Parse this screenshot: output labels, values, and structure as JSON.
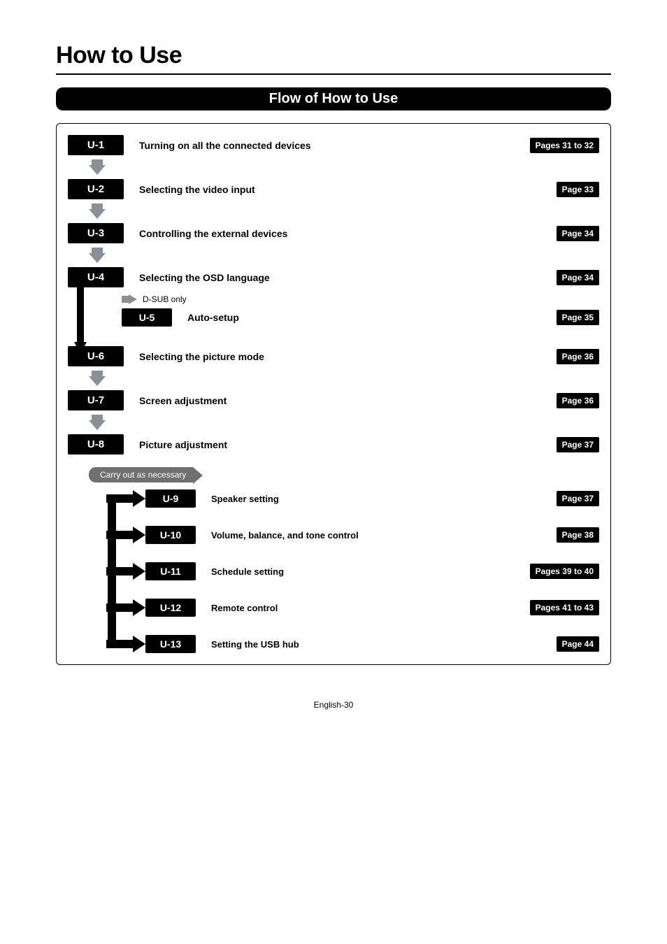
{
  "page_title": "How to Use",
  "section_bar": "Flow of How to Use",
  "steps": {
    "u1": {
      "id": "U-1",
      "title": "Turning on all the connected devices",
      "page": "Pages 31 to 32"
    },
    "u2": {
      "id": "U-2",
      "title": "Selecting the video input",
      "page": "Page 33"
    },
    "u3": {
      "id": "U-3",
      "title": "Controlling the external devices",
      "page": "Page 34"
    },
    "u4": {
      "id": "U-4",
      "title": "Selecting the OSD language",
      "page": "Page 34"
    },
    "u5": {
      "id": "U-5",
      "title": "Auto-setup",
      "page": "Page 35",
      "note": "D-SUB only"
    },
    "u6": {
      "id": "U-6",
      "title": "Selecting the picture mode",
      "page": "Page 36"
    },
    "u7": {
      "id": "U-7",
      "title": "Screen adjustment",
      "page": "Page 36"
    },
    "u8": {
      "id": "U-8",
      "title": "Picture adjustment",
      "page": "Page 37"
    }
  },
  "branch_note": "Carry out as necessary",
  "branches": {
    "u9": {
      "id": "U-9",
      "title": "Speaker setting",
      "page": "Page 37"
    },
    "u10": {
      "id": "U-10",
      "title": "Volume, balance, and tone control",
      "page": "Page 38"
    },
    "u11": {
      "id": "U-11",
      "title": "Schedule setting",
      "page": "Pages 39 to 40"
    },
    "u12": {
      "id": "U-12",
      "title": "Remote control",
      "page": "Pages 41 to 43"
    },
    "u13": {
      "id": "U-13",
      "title": "Setting the USB hub",
      "page": "Page 44"
    }
  },
  "footer": "English-30"
}
